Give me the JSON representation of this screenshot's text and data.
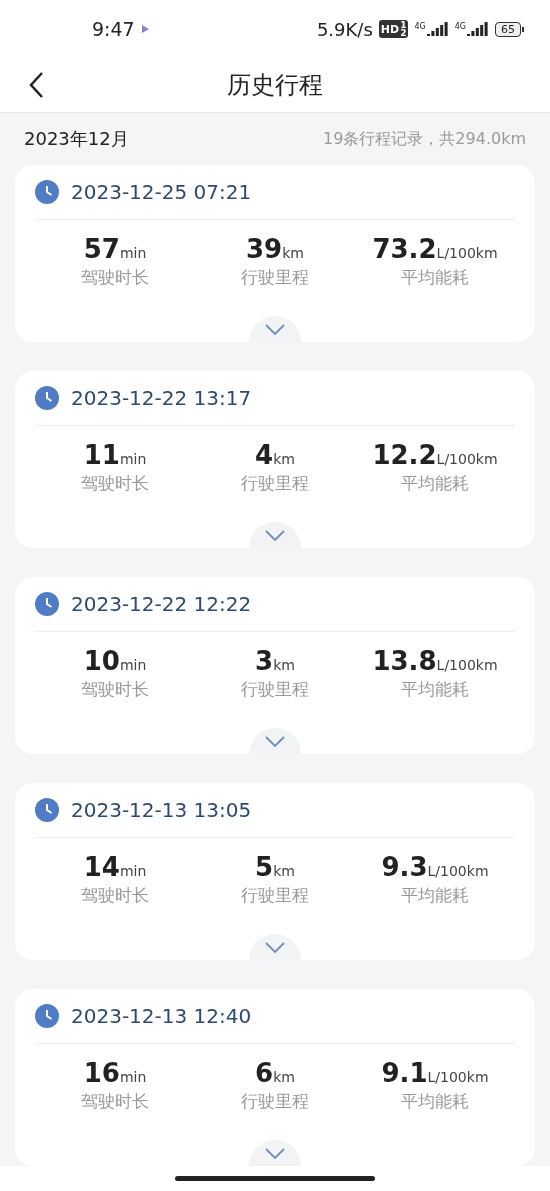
{
  "status_bar": {
    "time": "9:47",
    "speed": "5.9K/s",
    "hd_badge": {
      "label": "HD",
      "digits": [
        "1",
        "2"
      ]
    },
    "networks": [
      "4G",
      "4G"
    ],
    "battery": "65"
  },
  "header": {
    "title": "历史行程"
  },
  "month": {
    "label": "2023年12月",
    "summary": "19条行程记录，共294.0km"
  },
  "trips": [
    {
      "datetime": "2023-12-25 07:21",
      "stats": [
        {
          "value": "57",
          "unit": "min",
          "label": "驾驶时长"
        },
        {
          "value": "39",
          "unit": "km",
          "label": "行驶里程"
        },
        {
          "value": "73.2",
          "unit": "L/100km",
          "label": "平均能耗"
        }
      ]
    },
    {
      "datetime": "2023-12-22 13:17",
      "stats": [
        {
          "value": "11",
          "unit": "min",
          "label": "驾驶时长"
        },
        {
          "value": "4",
          "unit": "km",
          "label": "行驶里程"
        },
        {
          "value": "12.2",
          "unit": "L/100km",
          "label": "平均能耗"
        }
      ]
    },
    {
      "datetime": "2023-12-22 12:22",
      "stats": [
        {
          "value": "10",
          "unit": "min",
          "label": "驾驶时长"
        },
        {
          "value": "3",
          "unit": "km",
          "label": "行驶里程"
        },
        {
          "value": "13.8",
          "unit": "L/100km",
          "label": "平均能耗"
        }
      ]
    },
    {
      "datetime": "2023-12-13 13:05",
      "stats": [
        {
          "value": "14",
          "unit": "min",
          "label": "驾驶时长"
        },
        {
          "value": "5",
          "unit": "km",
          "label": "行驶里程"
        },
        {
          "value": "9.3",
          "unit": "L/100km",
          "label": "平均能耗"
        }
      ]
    },
    {
      "datetime": "2023-12-13 12:40",
      "stats": [
        {
          "value": "16",
          "unit": "min",
          "label": "驾驶时长"
        },
        {
          "value": "6",
          "unit": "km",
          "label": "行驶里程"
        },
        {
          "value": "9.1",
          "unit": "L/100km",
          "label": "平均能耗"
        }
      ]
    }
  ]
}
